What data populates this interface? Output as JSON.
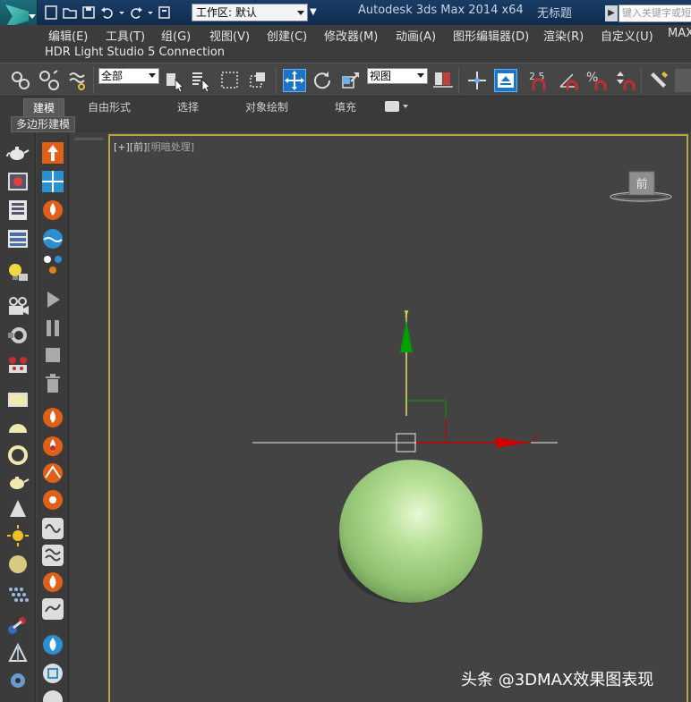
{
  "titlebar": {
    "workspace_label": "工作区: 默认",
    "app_title": "Autodesk 3ds Max  2014 x64",
    "doc_title": "无标题",
    "search_placeholder": "键入关键字或短语"
  },
  "menu": {
    "items": [
      "编辑(E)",
      "工具(T)",
      "组(G)",
      "视图(V)",
      "创建(C)",
      "修改器(M)",
      "动画(A)",
      "图形编辑器(D)",
      "渲染(R)",
      "自定义(U)",
      "MAX"
    ],
    "hdr_item": "HDR Light Studio 5 Connection"
  },
  "toolbar": {
    "selection_filter": "全部",
    "ref_coord": "视图",
    "angle_snap_label": "2.5",
    "percent_snap_label": "%"
  },
  "ribbon": {
    "tabs": [
      "建模",
      "自由形式",
      "选择",
      "对象绘制",
      "填充"
    ],
    "active_tab": "建模",
    "sub_label": "多边形建模"
  },
  "viewport": {
    "label_plus": "[+]",
    "label_view": "[前]",
    "label_shading": "[明暗处理]",
    "viewcube_face": "前",
    "axis_y": "y",
    "axis_x": "x",
    "sphere_color": "#a8d98a"
  },
  "colors": {
    "title_bg": "#123457",
    "ui_bg": "#444444",
    "viewport_border": "#b8a244",
    "axis_x": "#cc0000",
    "axis_y": "#00a000",
    "highlight": "#1a74c8"
  },
  "watermark": "头条 @3DMAX效果图表现"
}
